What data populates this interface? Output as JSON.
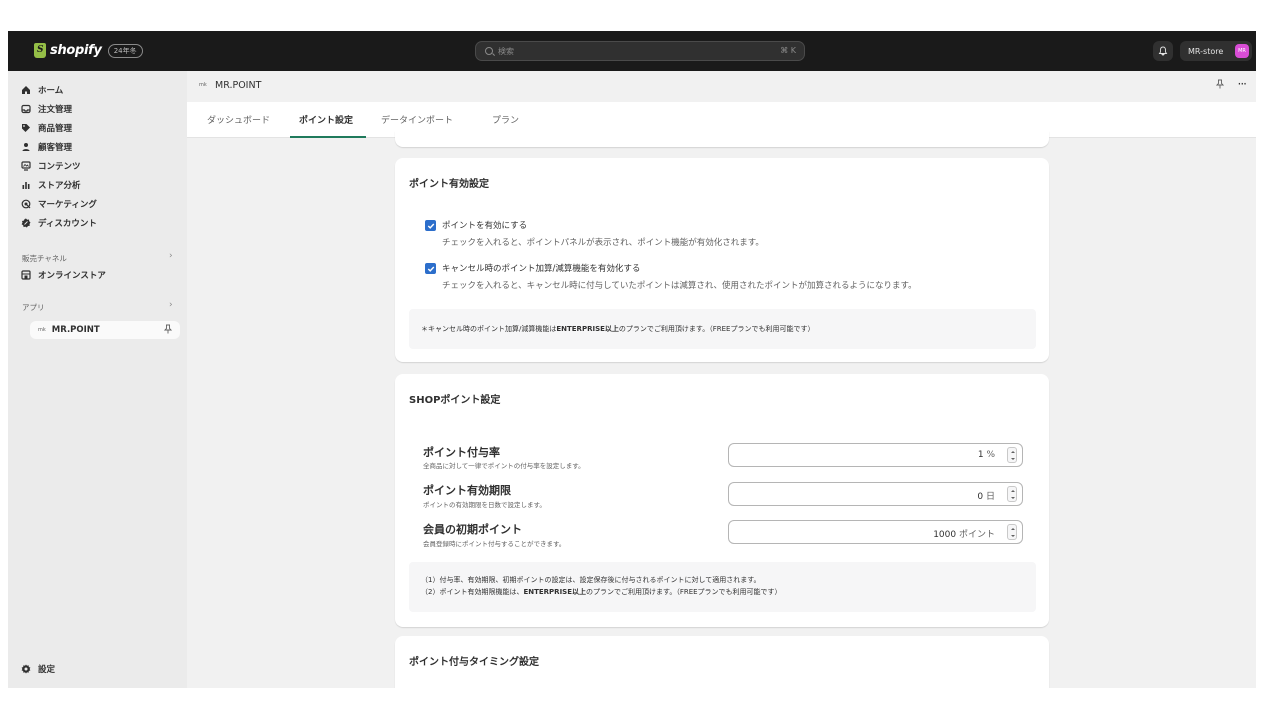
{
  "topbar": {
    "logo_text": "shopify",
    "logo_badge": "24年冬",
    "search_placeholder": "検索",
    "search_shortcut": "⌘ K",
    "store_name": "MR-store",
    "store_avatar": "MR"
  },
  "sidebar": {
    "items": [
      {
        "label": "ホーム",
        "icon": "home-icon"
      },
      {
        "label": "注文管理",
        "icon": "inbox-icon"
      },
      {
        "label": "商品管理",
        "icon": "tag-icon"
      },
      {
        "label": "顧客管理",
        "icon": "person-icon"
      },
      {
        "label": "コンテンツ",
        "icon": "content-icon"
      },
      {
        "label": "ストア分析",
        "icon": "chart-icon"
      },
      {
        "label": "マーケティング",
        "icon": "target-icon"
      },
      {
        "label": "ディスカウント",
        "icon": "discount-icon"
      }
    ],
    "sales_channels_label": "販売チャネル",
    "online_store_label": "オンラインストア",
    "apps_label": "アプリ",
    "app_item_label": "MR.POINT",
    "app_item_logo": "mk",
    "settings_label": "設定"
  },
  "app_header": {
    "logo": "mk",
    "title": "MR.POINT"
  },
  "tabs": [
    {
      "label": "ダッシュボード",
      "active": false
    },
    {
      "label": "ポイント設定",
      "active": true
    },
    {
      "label": "データインポート",
      "active": false
    },
    {
      "label": "プラン",
      "active": false
    }
  ],
  "point_enable": {
    "title": "ポイント有効設定",
    "options": [
      {
        "label": "ポイントを有効にする",
        "help": "チェックを入れると、ポイントパネルが表示され、ポイント機能が有効化されます。",
        "checked": true
      },
      {
        "label": "キャンセル時のポイント加算/減算機能を有効化する",
        "help": "チェックを入れると、キャンセル時に付与していたポイントは減算され、使用されたポイントが加算されるようになります。",
        "checked": true
      }
    ],
    "note_prefix": "＊キャンセル時のポイント加算/減算機能は",
    "note_bold": "ENTERPRISE以上",
    "note_suffix": "のプランでご利用頂けます。（FREEプランでも利用可能です）"
  },
  "shop_point": {
    "title": "SHOPポイント設定",
    "fields": [
      {
        "label": "ポイント付与率",
        "help": "全商品に対して一律でポイントの付与率を設定します。",
        "value": "1",
        "unit": "%"
      },
      {
        "label": "ポイント有効期限",
        "help": "ポイントの有効期限を日数で設定します。",
        "value": "0",
        "unit": "日"
      },
      {
        "label": "会員の初期ポイント",
        "help": "会員登録時にポイント付与することができます。",
        "value": "1000",
        "unit": "ポイント"
      }
    ],
    "note_line1": "（1）付与率、有効期限、初期ポイントの設定は、設定保存後に付与されるポイントに対して適用されます。",
    "note_line2_prefix": "（2）ポイント有効期限機能は、",
    "note_line2_bold": "ENTERPRISE以上",
    "note_line2_suffix": "のプランでご利用頂けます。（FREEプランでも利用可能です）"
  },
  "timing": {
    "title": "ポイント付与タイミング設定"
  },
  "colors": {
    "accent": "#2c6ecb",
    "tab_underline": "#1f7a5c",
    "topbar": "#1a1a1a",
    "avatar": "#d94dd6"
  }
}
